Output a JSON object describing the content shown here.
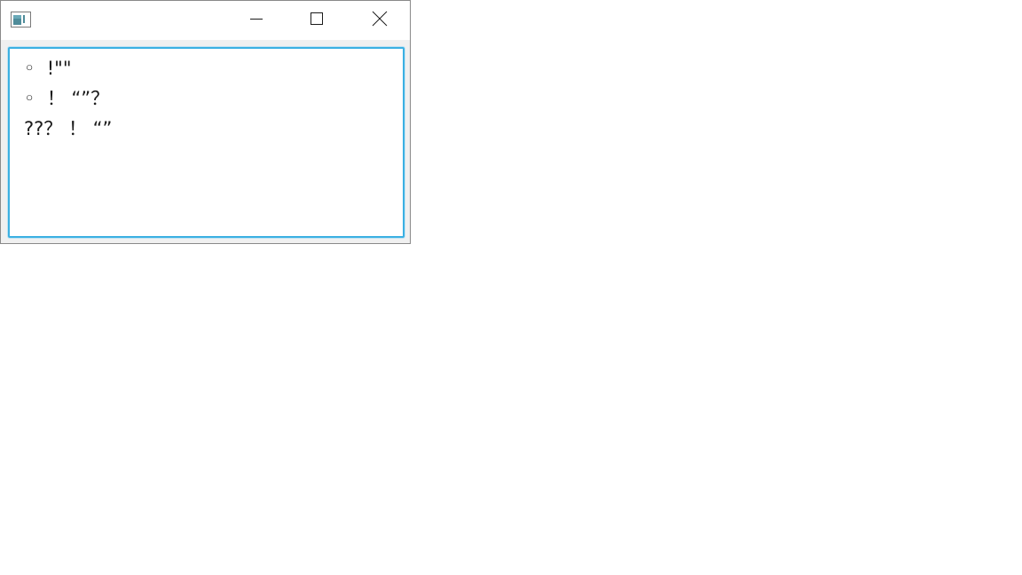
{
  "window": {
    "controls": {
      "minimize_icon": "minimize-icon",
      "maximize_icon": "maximize-icon",
      "close_icon": "close-icon"
    }
  },
  "editor": {
    "lines": [
      "◦  !\"\"",
      "◦  ！ “”？",
      "??？ ！ “”"
    ]
  },
  "colors": {
    "focus_border": "#3cb0e2",
    "window_border": "#8a8a8a",
    "chrome": "#f0f0f0",
    "text": "#1a1a1a"
  }
}
